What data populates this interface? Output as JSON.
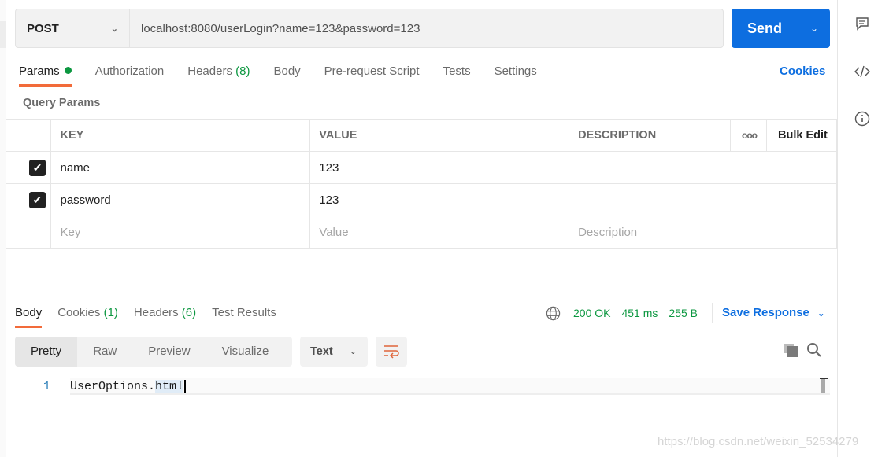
{
  "request": {
    "method": "POST",
    "url": "localhost:8080/userLogin?name=123&password=123",
    "send_label": "Send"
  },
  "tabs": {
    "params": "Params",
    "authorization": "Authorization",
    "headers": "Headers",
    "headers_count": "(8)",
    "body": "Body",
    "prerequest": "Pre-request Script",
    "tests": "Tests",
    "settings": "Settings",
    "cookies": "Cookies"
  },
  "query_params": {
    "title": "Query Params",
    "columns": [
      "KEY",
      "VALUE",
      "DESCRIPTION"
    ],
    "bulk_edit": "Bulk Edit",
    "rows": [
      {
        "key": "name",
        "value": "123",
        "checked": true
      },
      {
        "key": "password",
        "value": "123",
        "checked": true
      }
    ],
    "placeholders": {
      "key": "Key",
      "value": "Value",
      "description": "Description"
    }
  },
  "response": {
    "tabs": {
      "body": "Body",
      "cookies": "Cookies",
      "cookies_count": "(1)",
      "headers": "Headers",
      "headers_count": "(6)",
      "test_results": "Test Results"
    },
    "status": "200 OK",
    "time": "451 ms",
    "size": "255 B",
    "save_label": "Save Response",
    "views": [
      "Pretty",
      "Raw",
      "Preview",
      "Visualize"
    ],
    "format": "Text",
    "line_number": "1",
    "code_plain": "UserOptions.",
    "code_highlight": "html"
  },
  "watermark": "https://blog.csdn.net/weixin_52534279",
  "colors": {
    "accent": "#0d6ee0",
    "success": "#0c9740",
    "active_tab": "#f26b3a"
  }
}
